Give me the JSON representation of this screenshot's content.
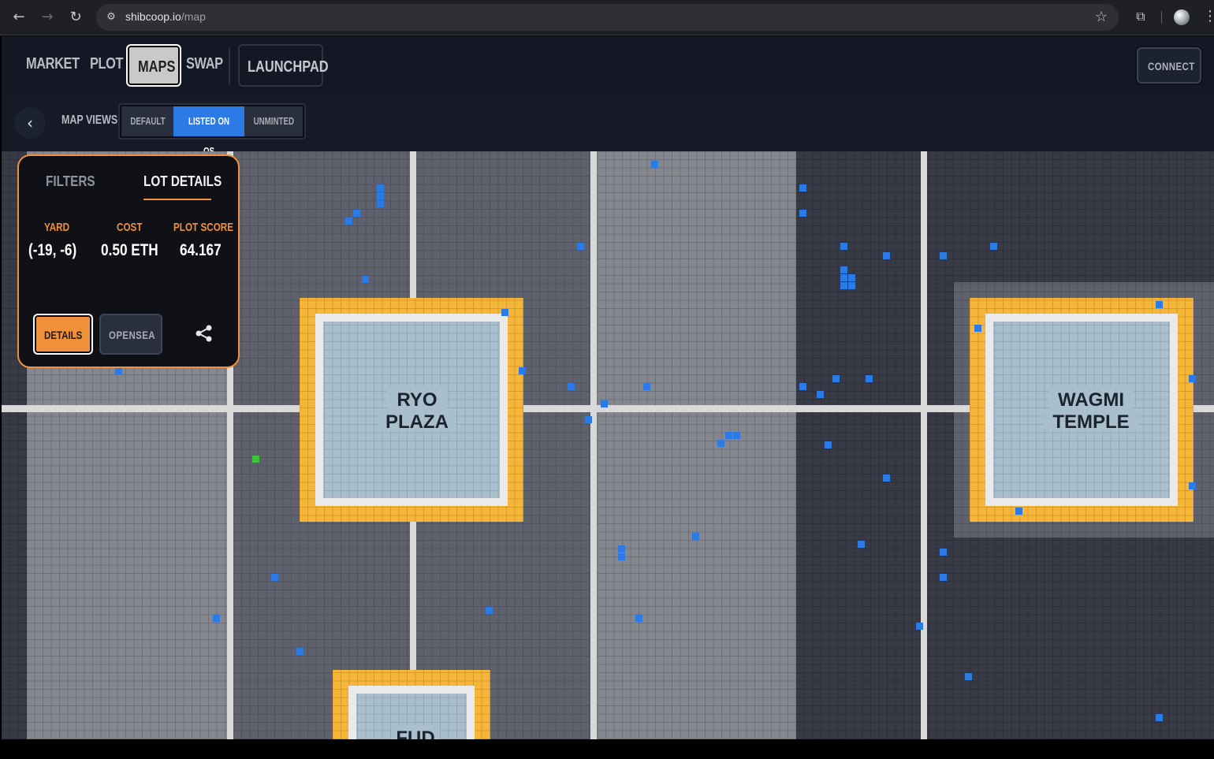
{
  "browser": {
    "url_host": "shibcoop.io",
    "url_path": "/map"
  },
  "nav": {
    "market": "MARKET",
    "plot": "PLOT",
    "maps": "MAPS",
    "swap": "SWAP",
    "launchpad": "LAUNCHPAD",
    "connect": "CONNECT"
  },
  "map_views": {
    "label": "MAP VIEWS:",
    "options": [
      "DEFAULT",
      "LISTED ON OS",
      "UNMINTED"
    ],
    "selected": "LISTED ON OS"
  },
  "panel": {
    "tabs": [
      "FILTERS",
      "LOT DETAILS"
    ],
    "active_tab": "LOT DETAILS",
    "yard_label": "YARD",
    "yard_value": "(-19, -6)",
    "cost_label": "COST",
    "cost_value": "0.50 ETH",
    "score_label": "PLOT SCORE",
    "score_value": "64.167",
    "details_button": "DETAILS",
    "opensea_button": "OPENSEA"
  },
  "landmarks": {
    "ryo": [
      "RYO",
      "PLAZA"
    ],
    "wagmi": [
      "WAGMI",
      "TEMPLE"
    ],
    "fud": [
      "FUD"
    ]
  },
  "colors": {
    "accent": "#f0913a",
    "listed_on_os": "#2c7be5",
    "selected_lot": "#3bc43b",
    "plaza_border": "#f5b73b",
    "plaza_fill": "#a9c0cc",
    "road": "#e6e6e6"
  }
}
